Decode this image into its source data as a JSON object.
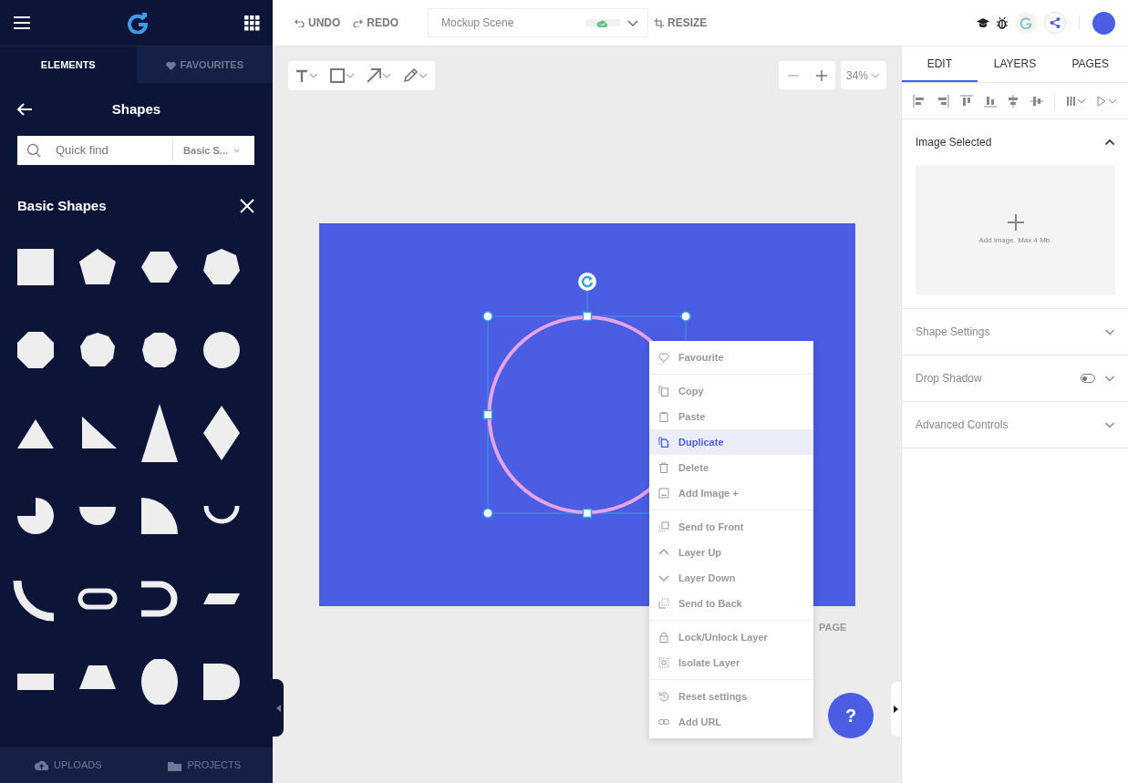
{
  "sidebar": {
    "tabs": [
      {
        "label": "ELEMENTS",
        "selected": true
      },
      {
        "label": "FAVOURITES",
        "selected": false
      }
    ],
    "title": "Shapes",
    "search": {
      "placeholder": "Quick find",
      "category": "Basic S..."
    },
    "section_title": "Basic Shapes",
    "bottom_tabs": [
      {
        "label": "UPLOADS"
      },
      {
        "label": "PROJECTS"
      }
    ]
  },
  "toolbar": {
    "undo": "UNDO",
    "redo": "REDO",
    "document_name": "Mockup Scene",
    "resize": "RESIZE"
  },
  "canvas": {
    "zoom": "34%",
    "page_label": "PAGE"
  },
  "context_menu": {
    "groups": [
      [
        {
          "label": "Favourite",
          "selected": false
        }
      ],
      [
        {
          "label": "Copy",
          "selected": false
        },
        {
          "label": "Paste",
          "selected": false
        },
        {
          "label": "Duplicate",
          "selected": true
        },
        {
          "label": "Delete",
          "selected": false
        },
        {
          "label": "Add Image +",
          "selected": false
        }
      ],
      [
        {
          "label": "Send to Front",
          "selected": false
        },
        {
          "label": "Layer Up",
          "selected": false
        },
        {
          "label": "Layer Down",
          "selected": false
        },
        {
          "label": "Send to Back",
          "selected": false
        }
      ],
      [
        {
          "label": "Lock/Unlock Layer",
          "selected": false
        },
        {
          "label": "Isolate Layer",
          "selected": false
        }
      ],
      [
        {
          "label": "Reset settings",
          "selected": false
        },
        {
          "label": "Add URL",
          "selected": false
        }
      ]
    ]
  },
  "help_button": "?",
  "right_panel": {
    "tabs": [
      {
        "label": "EDIT",
        "selected": true
      },
      {
        "label": "LAYERS",
        "selected": false
      },
      {
        "label": "PAGES",
        "selected": false
      }
    ],
    "sections": [
      {
        "title": "Image Selected",
        "expanded": true,
        "upload_hint": "Add image. Max 4 Mb."
      },
      {
        "title": "Shape Settings",
        "expanded": false
      },
      {
        "title": "Drop Shadow",
        "expanded": false,
        "toggle": {
          "on": false
        }
      },
      {
        "title": "Advanced Controls",
        "expanded": false
      }
    ]
  }
}
